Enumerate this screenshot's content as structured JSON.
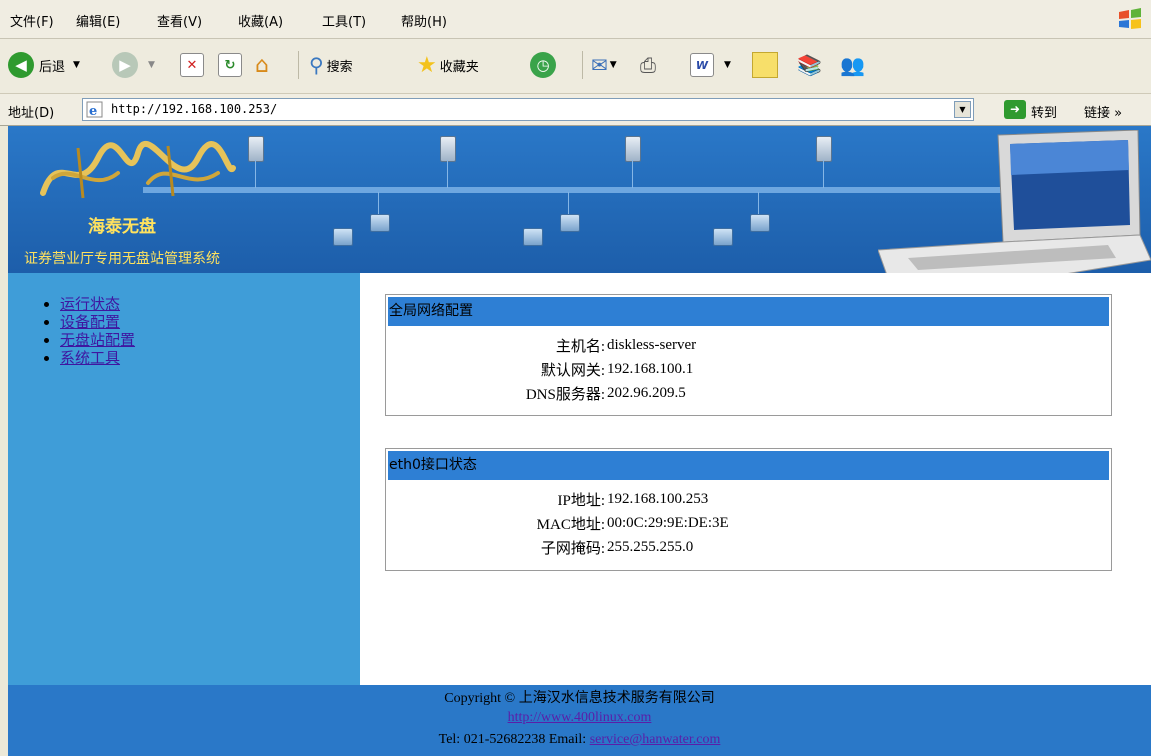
{
  "menu": [
    "文件(F)",
    "编辑(E)",
    "查看(V)",
    "收藏(A)",
    "工具(T)",
    "帮助(H)"
  ],
  "toolbar": {
    "back_label": "后退",
    "search_label": "搜索",
    "favorites_label": "收藏夹"
  },
  "address": {
    "label": "地址(D)",
    "url": "http://192.168.100.253/",
    "go_label": "转到",
    "links_label": "链接 »"
  },
  "banner": {
    "brand": "海泰无盘",
    "slogan": "证券营业厅专用无盘站管理系统"
  },
  "sidebar": {
    "items": [
      {
        "label": "运行状态"
      },
      {
        "label": "设备配置"
      },
      {
        "label": "无盘站配置"
      },
      {
        "label": "系统工具"
      }
    ]
  },
  "panels": [
    {
      "title": "全局网络配置",
      "rows": [
        {
          "key": "主机名:",
          "value": "diskless-server"
        },
        {
          "key": "默认网关:",
          "value": "192.168.100.1"
        },
        {
          "key": "DNS服务器:",
          "value": "202.96.209.5"
        }
      ]
    },
    {
      "title": "eth0接口状态",
      "rows": [
        {
          "key": "IP地址:",
          "value": "192.168.100.253"
        },
        {
          "key": "MAC地址:",
          "value": "00:0C:29:9E:DE:3E"
        },
        {
          "key": "子网掩码:",
          "value": "255.255.255.0"
        }
      ]
    }
  ],
  "footer": {
    "copyright": "Copyright © 上海汉水信息技术服务有限公司",
    "website": "http://www.400linux.com",
    "tel_email": "Tel: 021-52682238 Email: ",
    "email": "service@hanwater.com"
  },
  "colors": {
    "banner_blue": "#2a78c8",
    "sidebar_blue": "#3f9dd8",
    "panel_header": "#2e7fd4",
    "link_visited": "#5a1ea8"
  }
}
